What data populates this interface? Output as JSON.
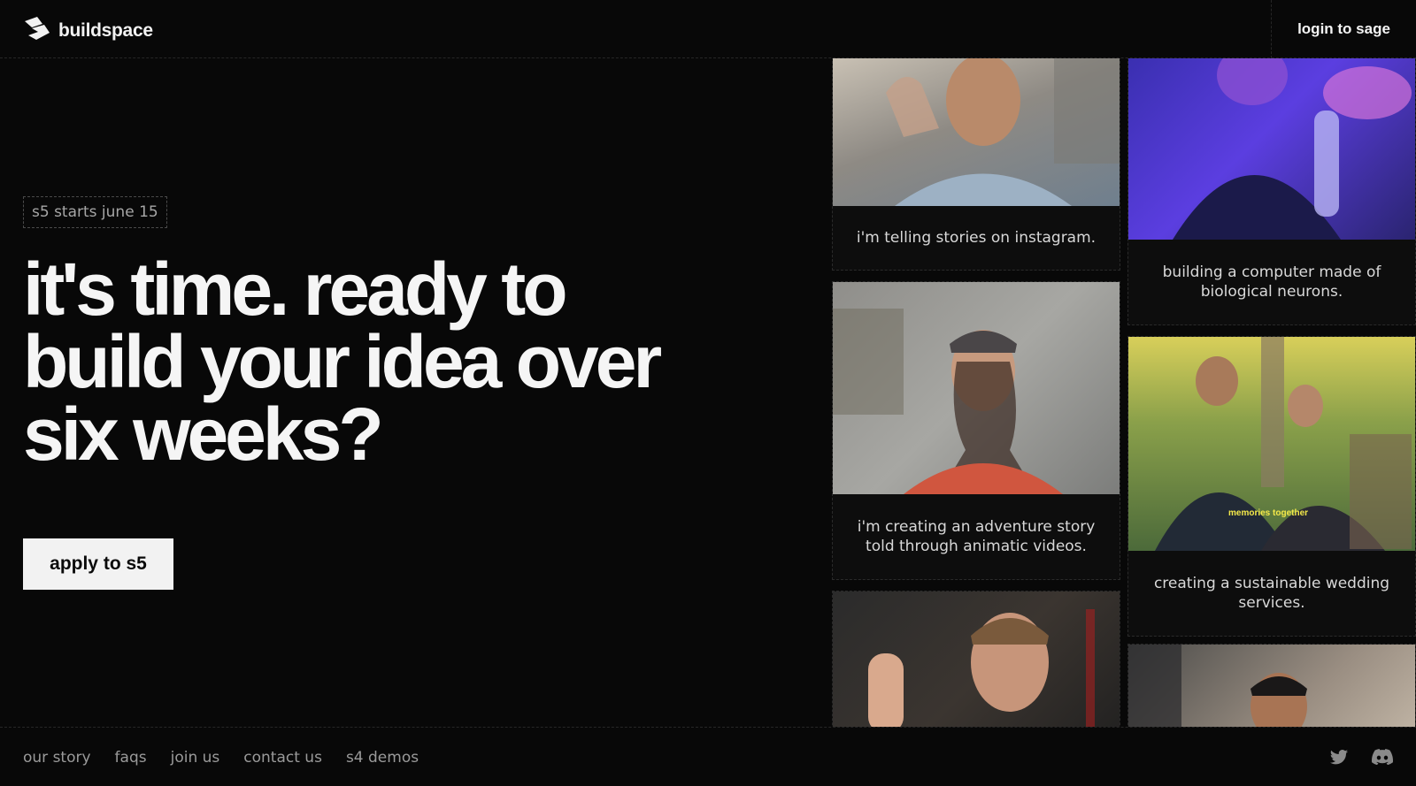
{
  "header": {
    "brand": "buildspace",
    "login_label": "login to sage"
  },
  "hero": {
    "badge": "s5 starts june 15",
    "headline": "it's time. ready to build your idea over six weeks?",
    "cta_label": "apply to s5"
  },
  "cards": [
    {
      "caption": "i'm telling stories on instagram."
    },
    {
      "caption": "building a computer made of biological neurons."
    },
    {
      "caption": "i'm creating an adventure story told through animatic videos."
    },
    {
      "caption": "creating a sustainable wedding services.",
      "photo_overlay": "memories together"
    }
  ],
  "footer": {
    "links": [
      "our story",
      "faqs",
      "join us",
      "contact us",
      "s4 demos"
    ]
  },
  "icons": {
    "brand": "buildspace-logo-icon",
    "social": [
      "twitter-icon",
      "discord-icon"
    ]
  },
  "colors": {
    "background": "#080808",
    "cta_background": "#f2f2f2",
    "text": "#f5f5f5",
    "muted_text": "#9a9a9a"
  }
}
